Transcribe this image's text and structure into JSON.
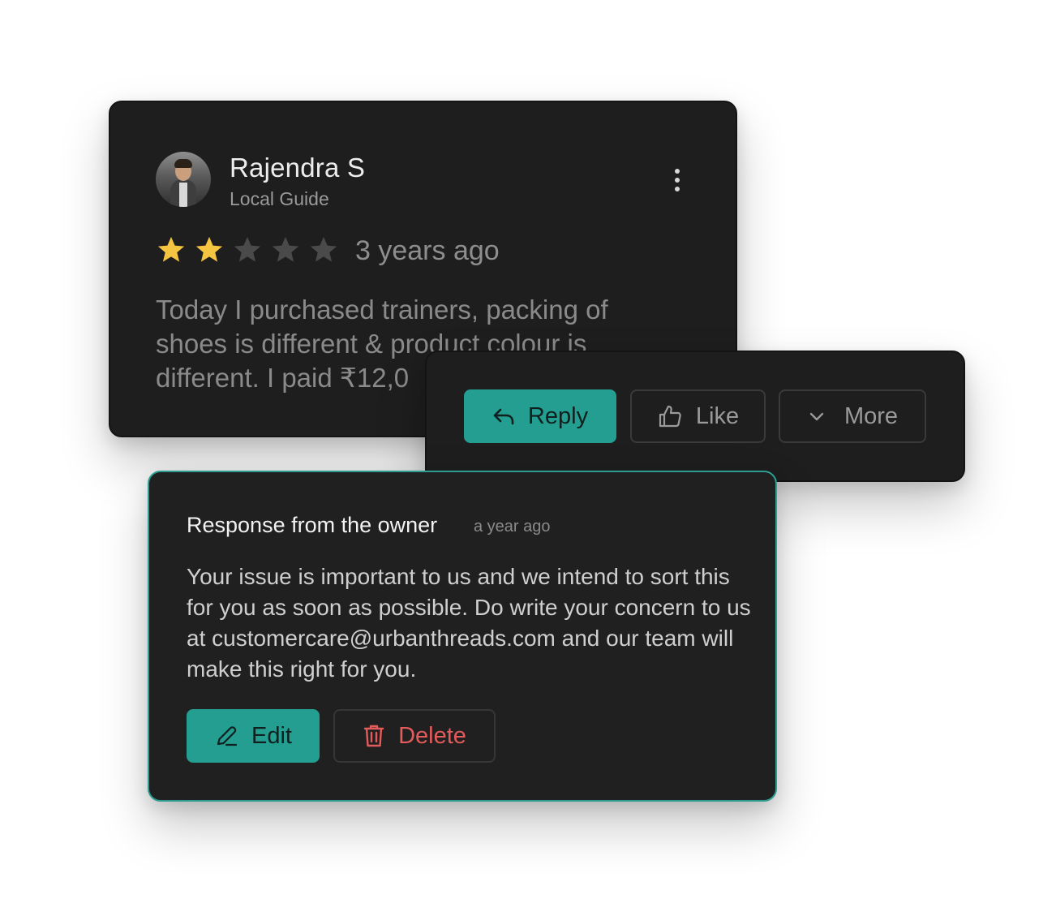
{
  "review": {
    "reviewer_name": "Rajendra S",
    "reviewer_role": "Local Guide",
    "rating": 2,
    "max_rating": 5,
    "time_ago": "3 years ago",
    "text": "Today I purchased trainers, packing of shoes is different & product colour is different. I paid ₹12,0"
  },
  "actions": {
    "reply_label": "Reply",
    "like_label": "Like",
    "more_label": "More"
  },
  "response": {
    "title": "Response from the owner",
    "time_ago": "a year ago",
    "text": "Your issue is important to us and we intend to sort this for you as soon as possible. Do write your concern to us at customercare@urbanthreads.com and our team will make this right for you.",
    "edit_label": "Edit",
    "delete_label": "Delete"
  },
  "colors": {
    "accent": "#239e91",
    "star_filled": "#f5c542",
    "star_empty": "#4a4a4a",
    "danger": "#e35b5b",
    "card_bg": "#1e1e1e"
  }
}
